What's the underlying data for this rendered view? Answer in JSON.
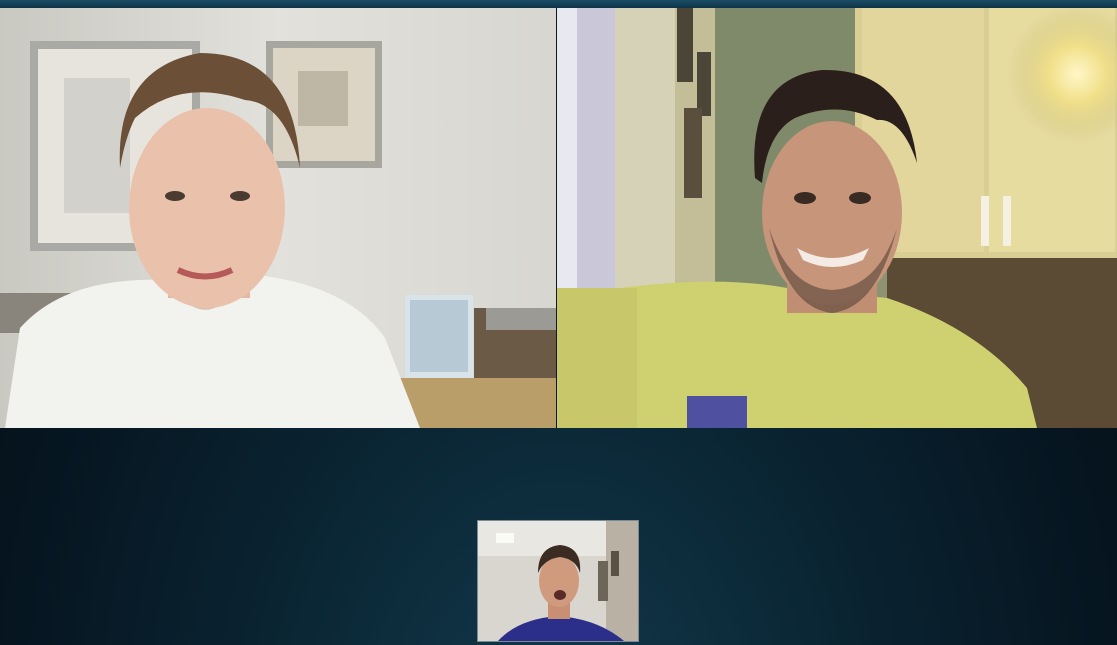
{
  "call": {
    "participants": [
      {
        "tile": "left",
        "shirt_color": "#f2f2ee",
        "wall_color": "#dcdcd6"
      },
      {
        "tile": "right",
        "shirt_color": "#cfd070",
        "wall_color": "#9aa07a"
      }
    ],
    "self_view": {
      "shirt_color": "#2b2f8a"
    },
    "colors": {
      "background": "#061520",
      "topbar": "#1b4d66"
    }
  }
}
